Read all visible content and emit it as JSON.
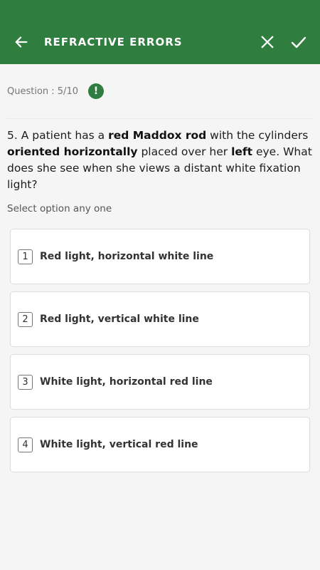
{
  "header": {
    "title": "REFRACTIVE ERRORS",
    "icons": {
      "back": "arrow-back-icon",
      "close": "close-icon",
      "submit": "check-icon"
    }
  },
  "question_meta": {
    "label": "Question : 5/10",
    "alert_glyph": "!"
  },
  "question": {
    "parts": [
      {
        "text": "5. A patient has a ",
        "bold": false
      },
      {
        "text": "red Maddox rod",
        "bold": true
      },
      {
        "text": " with the cylinders ",
        "bold": false
      },
      {
        "text": "oriented horizontally",
        "bold": true
      },
      {
        "text": " placed over her ",
        "bold": false
      },
      {
        "text": "left",
        "bold": true
      },
      {
        "text": " eye. What does she see when she views a distant white fixation light?",
        "bold": false
      }
    ]
  },
  "hint": "Select option any one",
  "options": [
    {
      "num": "1",
      "label": "Red light, horizontal white line"
    },
    {
      "num": "2",
      "label": "Red light, vertical white line"
    },
    {
      "num": "3",
      "label": "White light, horizontal red line"
    },
    {
      "num": "4",
      "label": "White light, vertical red line"
    }
  ],
  "colors": {
    "primary": "#2f7d3f",
    "background": "#f5f5f5",
    "card": "#ffffff"
  }
}
